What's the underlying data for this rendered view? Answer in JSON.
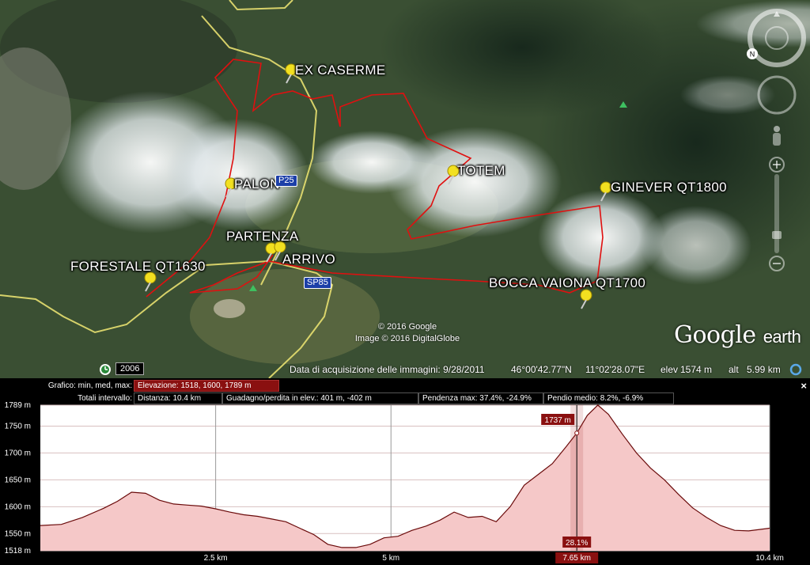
{
  "map": {
    "placemarks": [
      {
        "name": "ex-caserme",
        "label": "EX CASERME"
      },
      {
        "name": "palon",
        "label": "PALON"
      },
      {
        "name": "totem",
        "label": "TOTEM"
      },
      {
        "name": "ginever",
        "label": "GINEVER QT1800"
      },
      {
        "name": "partenza",
        "label": "PARTENZA"
      },
      {
        "name": "arrivo",
        "label": "ARRIVO"
      },
      {
        "name": "forestale",
        "label": "FORESTALE QT1630"
      },
      {
        "name": "bocca-vaiona",
        "label": "BOCCA VAIONA QT1700"
      }
    ],
    "roads": {
      "shield1": "P25",
      "shield2": "SP85"
    },
    "credit_line1": "© 2016 Google",
    "credit_line2": "Image © 2016 DigitalGlobe",
    "logo_main": "Google",
    "logo_sub": "earth",
    "historical_year": "2006",
    "status": {
      "acquisition": "Data di acquisizione delle immagini: 9/28/2011",
      "lat": "46°00'42.77\"N",
      "lon": "11°02'28.07\"E",
      "elev_label": "elev",
      "elev_value": "1574 m",
      "alt_label": "alt",
      "alt_value": "5.99 km"
    },
    "colors": {
      "track": "#e01010",
      "road": "#e8e070"
    }
  },
  "profile": {
    "row1_label": "Grafico: min, med, max:",
    "elevation": "Elevazione: 1518, 1600, 1789 m",
    "row2_label": "Totali intervallo:",
    "distance": "Distanza: 10.4 km",
    "gain_loss": "Guadagno/perdita in elev.: 401 m, -402 m",
    "max_slope": "Pendenza max: 37.4%, -24.9%",
    "avg_slope": "Pendio medio: 8.2%, -6.9%",
    "close_label": "×",
    "cursor_elev": "1737 m",
    "cursor_slope": "28.1%",
    "cursor_dist": "7.65 km",
    "colors": {
      "fill": "#f5c8c8",
      "line": "#6a0a0a",
      "accent": "#8a1010"
    }
  },
  "chart_data": {
    "type": "area",
    "title": "",
    "xlabel": "",
    "ylabel": "",
    "x_unit": "km",
    "y_unit": "m",
    "xlim": [
      0,
      10.4
    ],
    "ylim": [
      1518,
      1789
    ],
    "x_ticks": [
      {
        "v": 2.5,
        "label": "2.5 km"
      },
      {
        "v": 5,
        "label": "5 km"
      },
      {
        "v": 7.65,
        "label": "7.65 km"
      },
      {
        "v": 10.4,
        "label": "10.4 km"
      }
    ],
    "y_ticks": [
      {
        "v": 1789,
        "label": "1789 m"
      },
      {
        "v": 1750,
        "label": "1750 m"
      },
      {
        "v": 1700,
        "label": "1700 m"
      },
      {
        "v": 1650,
        "label": "1650 m"
      },
      {
        "v": 1600,
        "label": "1600 m"
      },
      {
        "v": 1550,
        "label": "1550 m"
      },
      {
        "v": 1518,
        "label": "1518 m"
      }
    ],
    "cursor_x": 7.65,
    "cursor_y": 1737,
    "series": [
      {
        "x": [
          0,
          0.3,
          0.6,
          0.9,
          1.1,
          1.3,
          1.5,
          1.7,
          1.9,
          2.1,
          2.3,
          2.5,
          2.7,
          2.9,
          3.1,
          3.3,
          3.5,
          3.7,
          3.9,
          4.1,
          4.3,
          4.5,
          4.7,
          4.9,
          5.1,
          5.3,
          5.5,
          5.7,
          5.9,
          6.1,
          6.3,
          6.5,
          6.7,
          6.9,
          7.1,
          7.3,
          7.5,
          7.65,
          7.8,
          7.95,
          8.1,
          8.3,
          8.5,
          8.7,
          8.9,
          9.1,
          9.3,
          9.5,
          9.7,
          9.9,
          10.1,
          10.4
        ],
        "y": [
          1565,
          1567,
          1580,
          1597,
          1610,
          1627,
          1625,
          1612,
          1605,
          1603,
          1601,
          1596,
          1590,
          1585,
          1582,
          1577,
          1572,
          1560,
          1548,
          1530,
          1524,
          1524,
          1530,
          1542,
          1545,
          1556,
          1564,
          1575,
          1590,
          1580,
          1582,
          1572,
          1600,
          1640,
          1660,
          1680,
          1712,
          1737,
          1770,
          1789,
          1772,
          1735,
          1700,
          1672,
          1650,
          1623,
          1598,
          1580,
          1565,
          1556,
          1555,
          1560
        ]
      }
    ]
  }
}
